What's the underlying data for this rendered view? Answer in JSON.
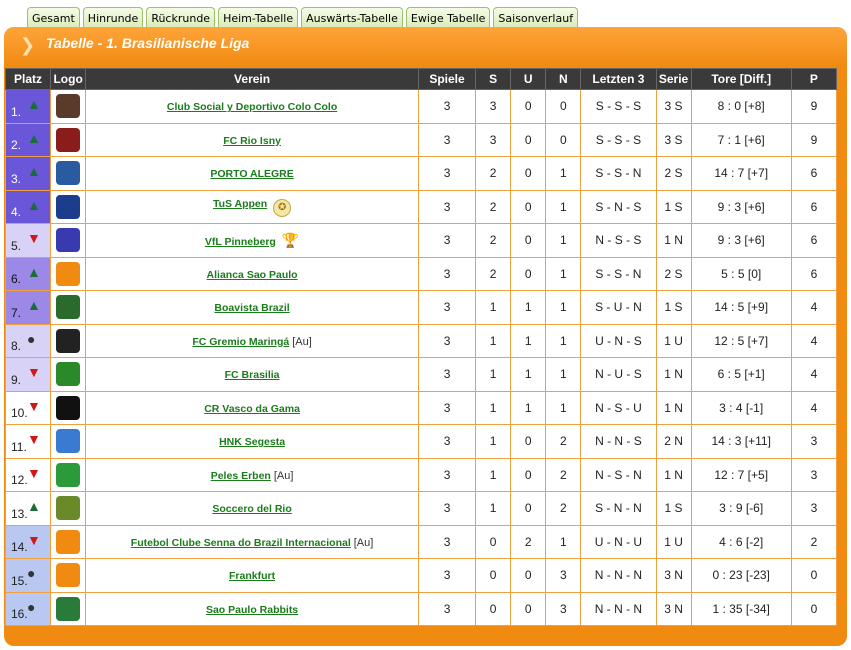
{
  "tabs": [
    {
      "label": "Gesamt"
    },
    {
      "label": "Hinrunde"
    },
    {
      "label": "Rückrunde"
    },
    {
      "label": "Heim-Tabelle"
    },
    {
      "label": "Auswärts-Tabelle"
    },
    {
      "label": "Ewige Tabelle"
    },
    {
      "label": "Saisonverlauf"
    }
  ],
  "title": "Tabelle - 1. Brasilianische Liga",
  "columns": {
    "platz": "Platz",
    "logo": "Logo",
    "verein": "Verein",
    "spiele": "Spiele",
    "s": "S",
    "u": "U",
    "n": "N",
    "letzten3": "Letzten 3",
    "serie": "Serie",
    "tore": "Tore [Diff.]",
    "p": "P"
  },
  "rows": [
    {
      "platz": "1.",
      "trend": "up",
      "zone": "blue",
      "logo_icon": "colo-colo-logo",
      "logo_color": "#5a3a2a",
      "club": "Club Social y Deportivo Colo Colo",
      "suffix": "",
      "badge": "",
      "spiele": "3",
      "s": "3",
      "u": "0",
      "n": "0",
      "letzten3": "S - S - S",
      "serie": "3 S",
      "tore": "8 : 0 [+8]",
      "p": "9"
    },
    {
      "platz": "2.",
      "trend": "up",
      "zone": "blue",
      "logo_icon": "fc-rio-isny-logo",
      "logo_color": "#8a1c1c",
      "club": "FC Rio Isny",
      "suffix": "",
      "badge": "",
      "spiele": "3",
      "s": "3",
      "u": "0",
      "n": "0",
      "letzten3": "S - S - S",
      "serie": "3 S",
      "tore": "7 : 1 [+6]",
      "p": "9"
    },
    {
      "platz": "3.",
      "trend": "up",
      "zone": "blue",
      "logo_icon": "porto-alegre-logo",
      "logo_color": "#2a5aa0",
      "club": "PORTO ALEGRE",
      "suffix": "",
      "badge": "",
      "spiele": "3",
      "s": "2",
      "u": "0",
      "n": "1",
      "letzten3": "S - S - N",
      "serie": "2 S",
      "tore": "14 : 7 [+7]",
      "p": "6"
    },
    {
      "platz": "4.",
      "trend": "up",
      "zone": "blue",
      "logo_icon": "tus-appen-logo",
      "logo_color": "#1c3c8c",
      "club": "TuS Appen",
      "suffix": "",
      "badge": "coin",
      "spiele": "3",
      "s": "2",
      "u": "0",
      "n": "1",
      "letzten3": "S - N - S",
      "serie": "1 S",
      "tore": "9 : 3 [+6]",
      "p": "6"
    },
    {
      "platz": "5.",
      "trend": "down",
      "zone": "lav",
      "logo_icon": "vfl-pinneberg-logo",
      "logo_color": "#3a3ab0",
      "club": "VfL Pinneberg",
      "suffix": "",
      "badge": "cup",
      "spiele": "3",
      "s": "2",
      "u": "0",
      "n": "1",
      "letzten3": "N - S - S",
      "serie": "1 N",
      "tore": "9 : 3 [+6]",
      "p": "6"
    },
    {
      "platz": "6.",
      "trend": "up",
      "zone": "purple",
      "logo_icon": "alianca-sao-paulo-logo",
      "logo_color": "#f08a10",
      "club": "Alianca Sao Paulo",
      "suffix": "",
      "badge": "",
      "spiele": "3",
      "s": "2",
      "u": "0",
      "n": "1",
      "letzten3": "S - S - N",
      "serie": "2 S",
      "tore": "5 : 5 [0]",
      "p": "6"
    },
    {
      "platz": "7.",
      "trend": "up",
      "zone": "purple",
      "logo_icon": "boavista-brazil-logo",
      "logo_color": "#2a6a2a",
      "club": "Boavista Brazil",
      "suffix": "",
      "badge": "",
      "spiele": "3",
      "s": "1",
      "u": "1",
      "n": "1",
      "letzten3": "S - U - N",
      "serie": "1 S",
      "tore": "14 : 5 [+9]",
      "p": "4"
    },
    {
      "platz": "8.",
      "trend": "same",
      "zone": "lav",
      "logo_icon": "fc-gremio-maringa-logo",
      "logo_color": "#222222",
      "club": "FC Gremio Maringá",
      "suffix": "[Au]",
      "badge": "",
      "spiele": "3",
      "s": "1",
      "u": "1",
      "n": "1",
      "letzten3": "U - N - S",
      "serie": "1 U",
      "tore": "12 : 5 [+7]",
      "p": "4"
    },
    {
      "platz": "9.",
      "trend": "down",
      "zone": "lav",
      "logo_icon": "fc-brasilia-logo",
      "logo_color": "#2a8a2a",
      "club": "FC Brasilia",
      "suffix": "",
      "badge": "",
      "spiele": "3",
      "s": "1",
      "u": "1",
      "n": "1",
      "letzten3": "N - U - S",
      "serie": "1 N",
      "tore": "6 : 5 [+1]",
      "p": "4"
    },
    {
      "platz": "10.",
      "trend": "down",
      "zone": "white",
      "logo_icon": "cr-vasco-da-gama-logo",
      "logo_color": "#111111",
      "club": "CR Vasco da Gama",
      "suffix": "",
      "badge": "",
      "spiele": "3",
      "s": "1",
      "u": "1",
      "n": "1",
      "letzten3": "N - S - U",
      "serie": "1 N",
      "tore": "3 : 4 [-1]",
      "p": "4"
    },
    {
      "platz": "11.",
      "trend": "down",
      "zone": "white",
      "logo_icon": "hnk-segesta-logo",
      "logo_color": "#3a7ad0",
      "club": "HNK Segesta",
      "suffix": "",
      "badge": "",
      "spiele": "3",
      "s": "1",
      "u": "0",
      "n": "2",
      "letzten3": "N - N - S",
      "serie": "2 N",
      "tore": "14 : 3 [+11]",
      "p": "3"
    },
    {
      "platz": "12.",
      "trend": "down",
      "zone": "white",
      "logo_icon": "peles-erben-logo",
      "logo_color": "#2a9a3a",
      "club": "Peles Erben",
      "suffix": "[Au]",
      "badge": "",
      "spiele": "3",
      "s": "1",
      "u": "0",
      "n": "2",
      "letzten3": "N - S - N",
      "serie": "1 N",
      "tore": "12 : 7 [+5]",
      "p": "3"
    },
    {
      "platz": "13.",
      "trend": "up",
      "zone": "white",
      "logo_icon": "soccero-del-rio-logo",
      "logo_color": "#6a8a2a",
      "club": "Soccero del Rio",
      "suffix": "",
      "badge": "",
      "spiele": "3",
      "s": "1",
      "u": "0",
      "n": "2",
      "letzten3": "S - N - N",
      "serie": "1 S",
      "tore": "3 : 9 [-6]",
      "p": "3"
    },
    {
      "platz": "14.",
      "trend": "down",
      "zone": "lblue",
      "logo_icon": "futebol-clube-senna-logo",
      "logo_color": "#f08a10",
      "club": "Futebol Clube Senna do Brazil Internacional",
      "suffix": "[Au]",
      "badge": "",
      "spiele": "3",
      "s": "0",
      "u": "2",
      "n": "1",
      "letzten3": "U - N - U",
      "serie": "1 U",
      "tore": "4 : 6 [-2]",
      "p": "2"
    },
    {
      "platz": "15.",
      "trend": "same",
      "zone": "lblue",
      "logo_icon": "frankfurt-logo",
      "logo_color": "#f08a10",
      "club": "Frankfurt",
      "suffix": "",
      "badge": "",
      "spiele": "3",
      "s": "0",
      "u": "0",
      "n": "3",
      "letzten3": "N - N - N",
      "serie": "3 N",
      "tore": "0 : 23 [-23]",
      "p": "0"
    },
    {
      "platz": "16.",
      "trend": "same",
      "zone": "lblue",
      "logo_icon": "sao-paulo-rabbits-logo",
      "logo_color": "#2a7a3a",
      "club": "Sao Paulo Rabbits",
      "suffix": "",
      "badge": "",
      "spiele": "3",
      "s": "0",
      "u": "0",
      "n": "3",
      "letzten3": "N - N - N",
      "serie": "3 N",
      "tore": "1 : 35 [-34]",
      "p": "0"
    }
  ]
}
